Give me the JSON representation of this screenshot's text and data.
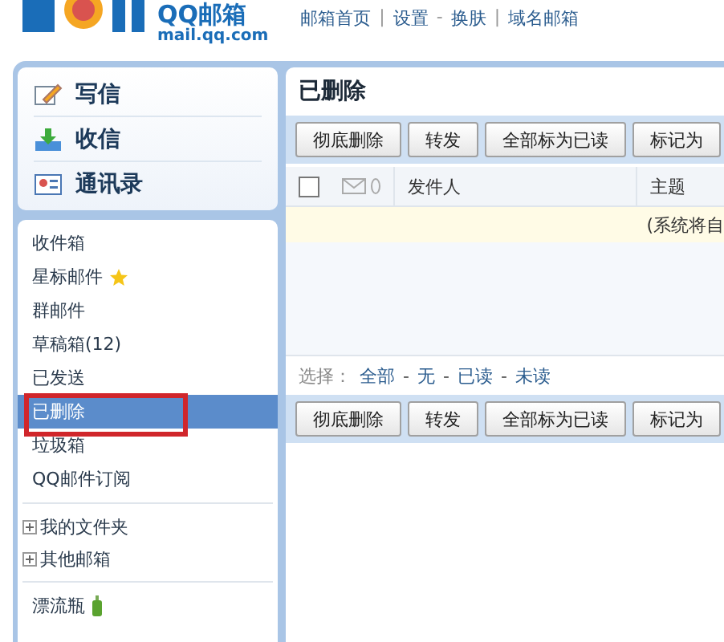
{
  "header": {
    "logo_name": "QQ邮箱",
    "logo_domain": "mail.qq.com",
    "nav": [
      {
        "kind": "link",
        "label": "邮箱首页"
      },
      {
        "kind": "sep",
        "label": "|"
      },
      {
        "kind": "link",
        "label": "设置"
      },
      {
        "kind": "sep",
        "label": "-"
      },
      {
        "kind": "link",
        "label": "换肤"
      },
      {
        "kind": "sep",
        "label": "|"
      },
      {
        "kind": "link",
        "label": "域名邮箱"
      }
    ]
  },
  "quick_actions": [
    {
      "kind": "compose",
      "label": "写信"
    },
    {
      "kind": "inbox",
      "label": "收信"
    },
    {
      "kind": "contacts",
      "label": "通讯录"
    }
  ],
  "folders": [
    {
      "label": "收件箱",
      "selected": false
    },
    {
      "label": "星标邮件",
      "selected": false,
      "kind": "starred"
    },
    {
      "label": "群邮件",
      "selected": false
    },
    {
      "label": "草稿箱(12)",
      "selected": false
    },
    {
      "label": "已发送",
      "selected": false
    },
    {
      "label": "已删除",
      "selected": true
    },
    {
      "label": "垃圾箱",
      "selected": false
    },
    {
      "label": "QQ邮件订阅",
      "selected": false
    }
  ],
  "folder_groups": [
    {
      "label": "我的文件夹",
      "expanded": false
    },
    {
      "label": "其他邮箱",
      "expanded": false
    }
  ],
  "extras": [
    {
      "label": "漂流瓶",
      "kind": "bottle"
    }
  ],
  "main": {
    "title": "已删除",
    "toolbar_top": [
      "彻底删除",
      "转发",
      "全部标为已读",
      "标记为"
    ],
    "select_all": {
      "checked": false
    },
    "columns": [
      "发件人",
      "主题"
    ],
    "notice": "(系统将自",
    "select_bar": {
      "label": "选择：",
      "separator": "-",
      "options": [
        "全部",
        "无",
        "已读",
        "未读"
      ]
    },
    "toolbar_bottom": [
      "彻底删除",
      "转发",
      "全部标为已读",
      "标记为"
    ]
  }
}
